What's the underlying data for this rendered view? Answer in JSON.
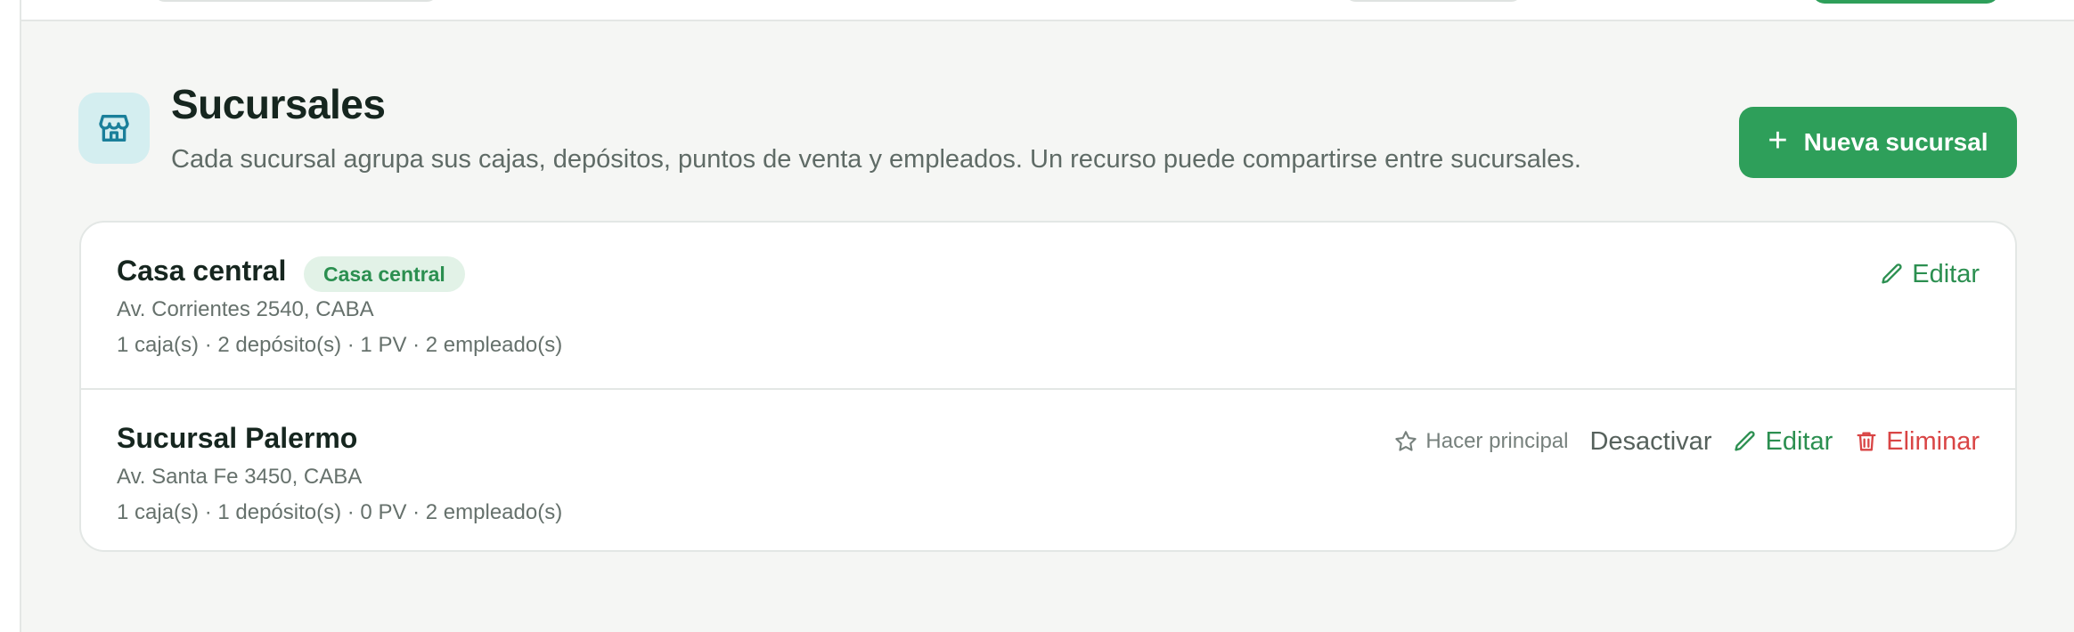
{
  "header": {
    "title": "Sucursales",
    "subtitle": "Cada sucursal agrupa sus cajas, depósitos, puntos de venta y empleados. Un recurso puede compartirse entre sucursales.",
    "icon": "store-icon",
    "new_button_label": "Nueva sucursal"
  },
  "branches": [
    {
      "name": "Casa central",
      "badge": "Casa central",
      "address": "Av. Corrientes 2540, CABA",
      "stats": "1 caja(s) · 2 depósito(s) · 1 PV · 2 empleado(s)",
      "actions": {
        "edit": "Editar"
      }
    },
    {
      "name": "Sucursal Palermo",
      "address": "Av. Santa Fe 3450, CABA",
      "stats": "1 caja(s) · 1 depósito(s) · 0 PV · 2 empleado(s)",
      "actions": {
        "make_main": "Hacer principal",
        "deactivate": "Desactivar",
        "edit": "Editar",
        "delete": "Eliminar"
      }
    }
  ],
  "colors": {
    "accent": "#2e9f5a",
    "danger": "#d94545",
    "icon_bg": "#d4eef0",
    "page_bg": "#f5f6f4"
  }
}
